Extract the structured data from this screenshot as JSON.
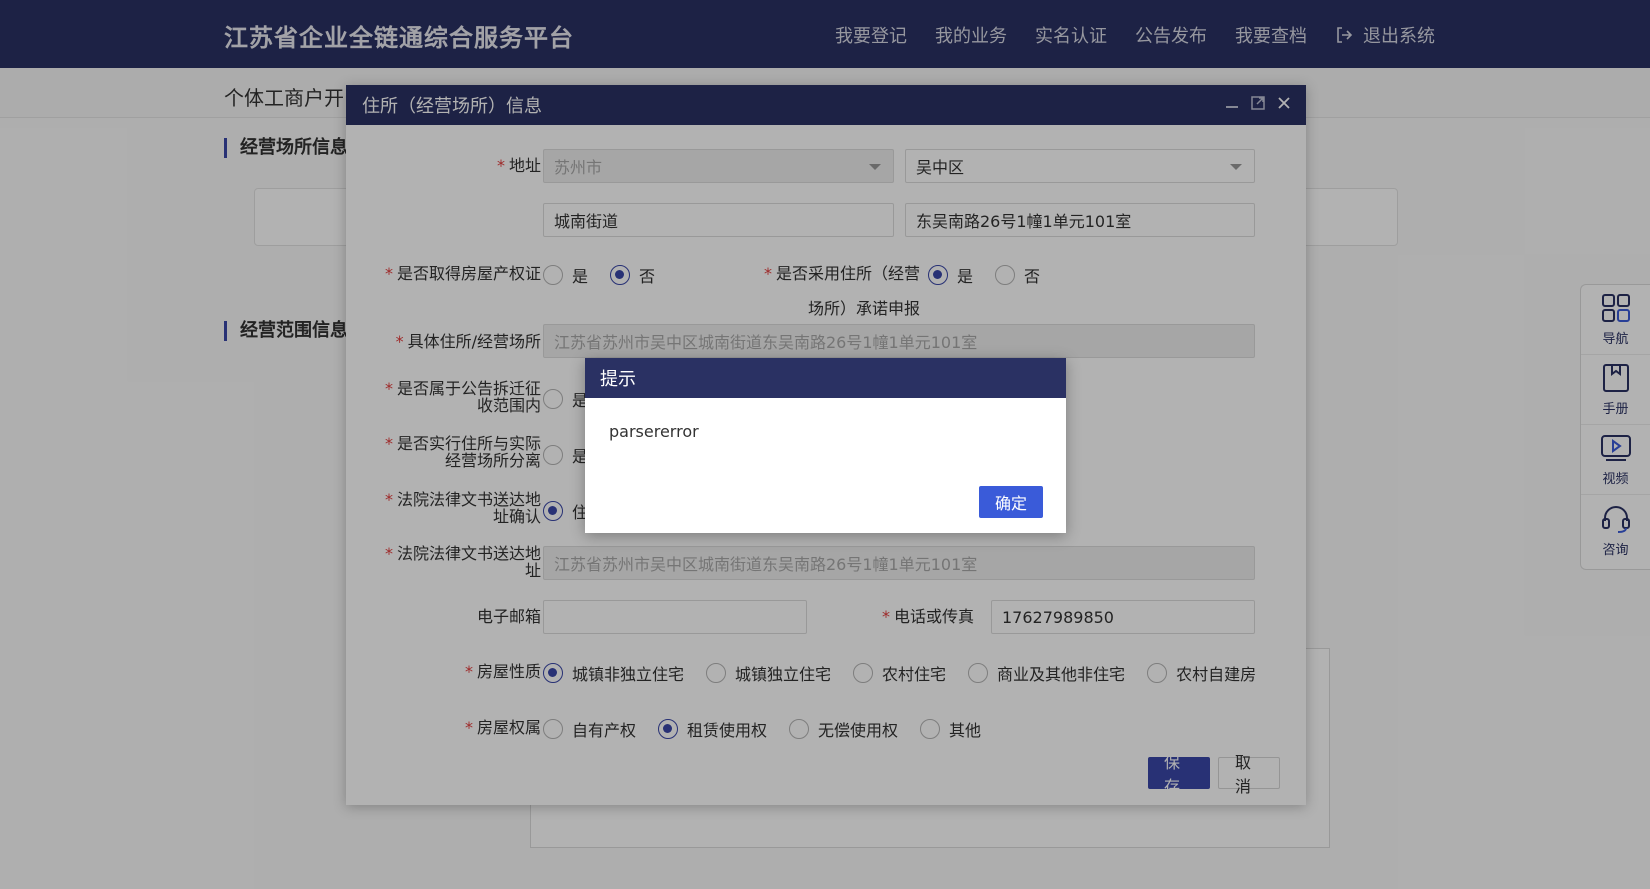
{
  "header": {
    "brand": "江苏省企业全链通综合服务平台",
    "nav": [
      "我要登记",
      "我的业务",
      "实名认证",
      "公告发布",
      "我要查档"
    ],
    "logout": "退出系统"
  },
  "page": {
    "subheader": "个体工商户开",
    "section1": "经营场所信息",
    "section2": "经营范围信息"
  },
  "sidebar": [
    {
      "label": "导航",
      "icon": "grid-icon"
    },
    {
      "label": "手册",
      "icon": "bookmark-icon"
    },
    {
      "label": "视频",
      "icon": "video-play-icon"
    },
    {
      "label": "咨询",
      "icon": "headset-icon"
    }
  ],
  "dialog": {
    "title": "住所（经营场所）信息",
    "address": {
      "label": "地址",
      "city": "苏州市",
      "district": "吴中区",
      "street": "城南街道",
      "detail": "东吴南路26号1幢1单元101室"
    },
    "property_cert": {
      "label": "是否取得房屋产权证",
      "options": [
        "是",
        "否"
      ],
      "selected": "否"
    },
    "commitment": {
      "label_line1": "是否采用住所（经营",
      "label_line2": "场所）承诺申报",
      "options": [
        "是",
        "否"
      ],
      "selected": "是"
    },
    "specific_addr": {
      "label": "具体住所/经营场所",
      "value": "江苏省苏州市吴中区城南街道东吴南路26号1幢1单元101室"
    },
    "demolition": {
      "label_line1": "是否属于公告拆迁征",
      "label_line2": "收范围内",
      "option_partial": "是"
    },
    "separation": {
      "label_line1": "是否实行住所与实际",
      "label_line2": "经营场所分离",
      "option_partial": "是"
    },
    "court_confirm": {
      "label_line1": "法院法律文书送达地",
      "label_line2": "址确认",
      "option_partial": "住"
    },
    "court_addr": {
      "label_line1": "法院法律文书送达地",
      "label_line2": "址",
      "value": "江苏省苏州市吴中区城南街道东吴南路26号1幢1单元101室"
    },
    "email": {
      "label": "电子邮箱",
      "value": ""
    },
    "phone": {
      "label": "电话或传真",
      "value": "17627989850"
    },
    "house_nature": {
      "label": "房屋性质",
      "options": [
        "城镇非独立住宅",
        "城镇独立住宅",
        "农村住宅",
        "商业及其他非住宅",
        "农村自建房"
      ],
      "selected": "城镇非独立住宅"
    },
    "house_right": {
      "label": "房屋权属",
      "options": [
        "自有产权",
        "租赁使用权",
        "无偿使用权",
        "其他"
      ],
      "selected": "租赁使用权"
    },
    "save": "保存",
    "cancel": "取消"
  },
  "alert": {
    "title": "提示",
    "message": "parsererror",
    "ok": "确定"
  },
  "colors": {
    "primary": "#2a3163",
    "accent": "#3a47a8",
    "required": "#e23c3c",
    "ok_button": "#3a5bd9"
  }
}
